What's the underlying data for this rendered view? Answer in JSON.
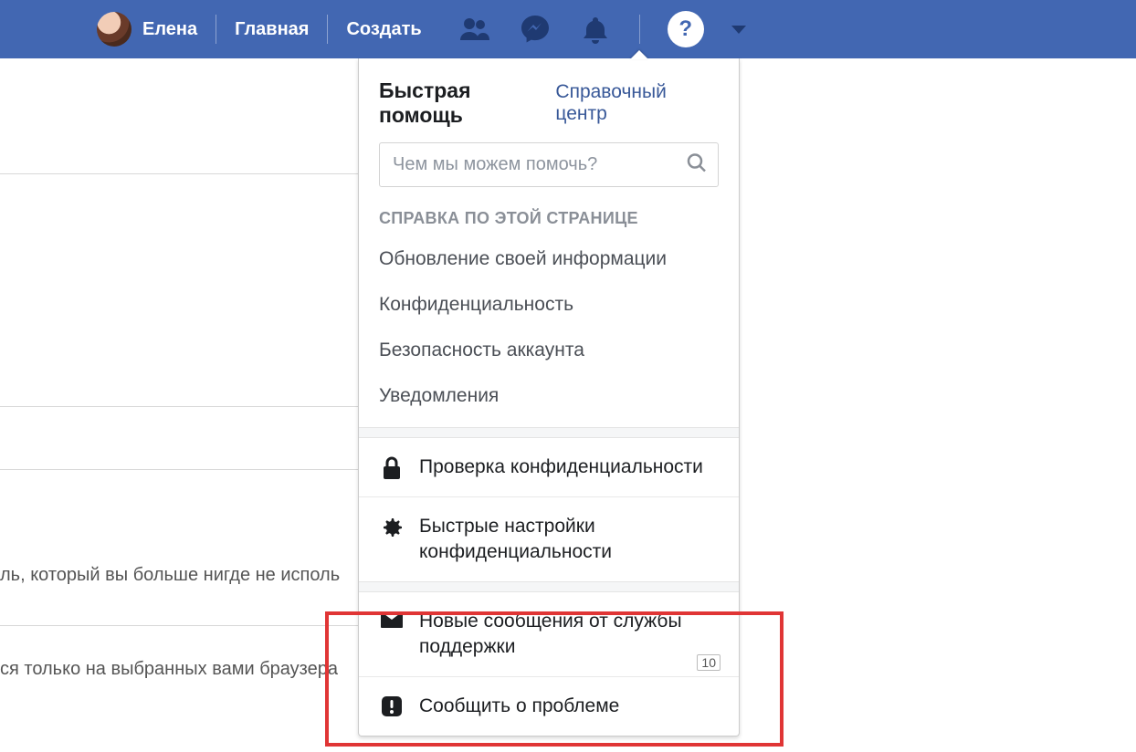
{
  "topbar": {
    "user_name": "Елена",
    "links": {
      "home": "Главная",
      "create": "Создать"
    }
  },
  "help_panel": {
    "title": "Быстрая помощь",
    "help_center": "Справочный центр",
    "search_placeholder": "Чем мы можем помочь?",
    "section_heading": "СПРАВКА ПО ЭТОЙ СТРАНИЦЕ",
    "topics": {
      "update_info": "Обновление своей информации",
      "privacy": "Конфиденциальность",
      "account_security": "Безопасность аккаунта",
      "notifications": "Уведомления"
    },
    "privacy_checkup": "Проверка конфиденциальности",
    "privacy_shortcuts": "Быстрые настройки конфиденциальности",
    "support_inbox": "Новые сообщения от службы поддержки",
    "support_badge": "10",
    "report_problem": "Сообщить о проблеме"
  },
  "background": {
    "line1": "ль, который вы больше нигде не исполь",
    "line2": "ся только на выбранных вами браузера"
  }
}
